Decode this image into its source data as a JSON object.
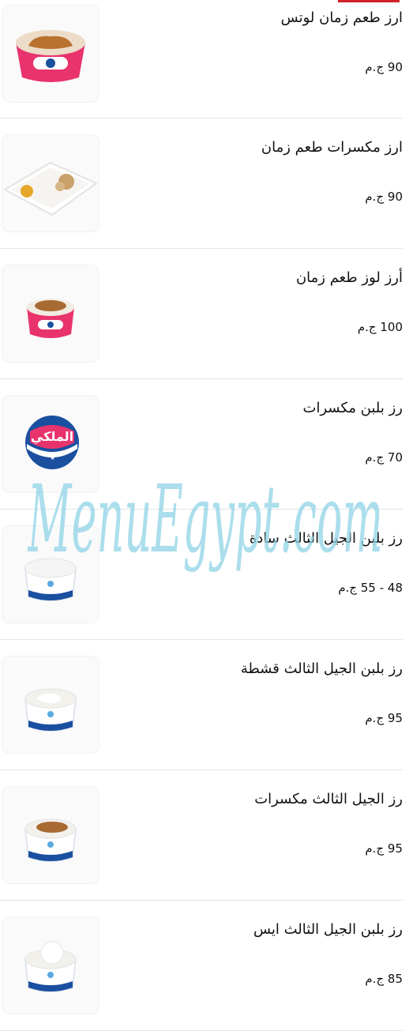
{
  "menu": {
    "items": [
      {
        "name": "ارز طعم زمان لوتس",
        "price": "90 ج.م",
        "image": "lotus-rice-pudding-cup"
      },
      {
        "name": "ارز مكسرات طعم زمان",
        "price": "90 ج.م",
        "image": "nuts-rice-pudding-tray"
      },
      {
        "name": "أرز لوز طعم زمان",
        "price": "100 ج.م",
        "image": "almond-rice-pudding-cup"
      },
      {
        "name": "رز بلبن مكسرات",
        "price": "70 ج.م",
        "image": "brand-logo-placeholder"
      },
      {
        "name": "رز بلبن الجيل الثالث سادة",
        "price": "48 - 55 ج.م",
        "image": "plain-rice-pudding-cup"
      },
      {
        "name": "رز بلبن الجيل الثالث قشطة",
        "price": "95 ج.م",
        "image": "cream-rice-pudding-cup"
      },
      {
        "name": "رز الجيل الثالث مكسرات",
        "price": "95 ج.م",
        "image": "nuts-rice-pudding-cup"
      },
      {
        "name": "رز بلبن الجيل الثالث ايس",
        "price": "85 ج.م",
        "image": "ice-cream-rice-pudding-cup"
      }
    ]
  },
  "brand_logo": {
    "text": "الملكي"
  },
  "watermark": {
    "text": "MenuEgypt.com"
  },
  "colors": {
    "accent": "#d0202a",
    "watermark": "#8fd3e6",
    "cup_pink": "#e8336d",
    "cup_blue": "#1b4fa0"
  }
}
